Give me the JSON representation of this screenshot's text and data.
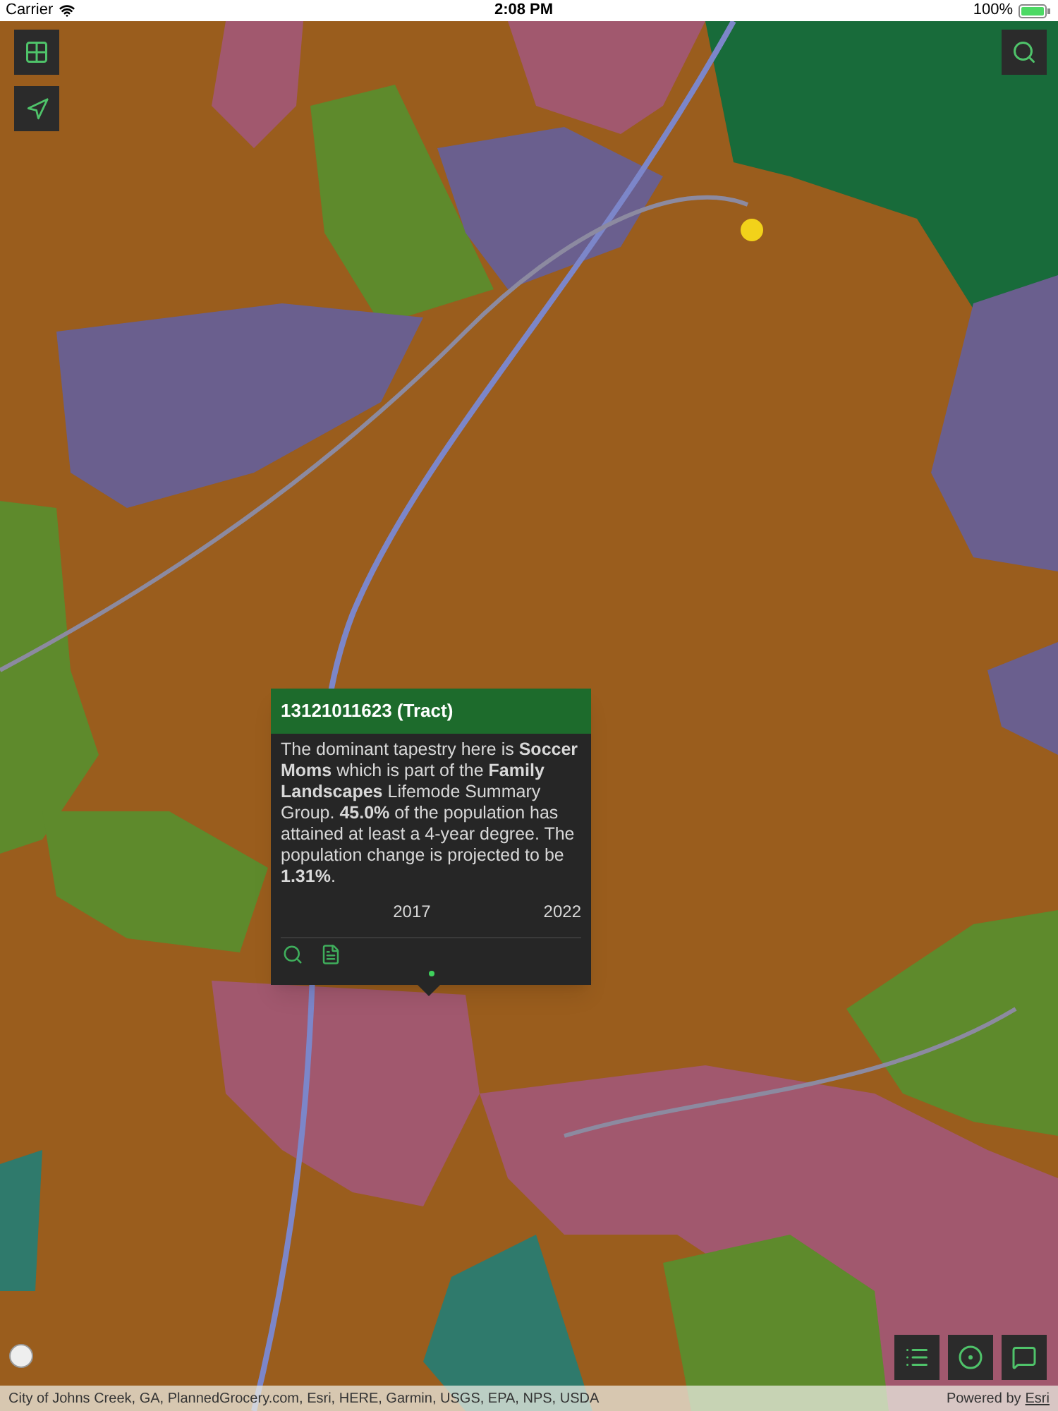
{
  "status_bar": {
    "carrier": "Carrier",
    "time": "2:08 PM",
    "battery": "100%"
  },
  "popup": {
    "title": "13121011623 (Tract)",
    "description": "The dominant tapestry here is **Soccer Moms** which is part of the **Family Landscapes** Lifemode Summary Group. **45.0%** of the population has attained at least a 4-year degree. The population change is projected to be **1.31%**.",
    "table": {
      "columns": [
        "2017",
        "2022"
      ]
    },
    "page_dots": [
      {
        "selected": true
      }
    ]
  },
  "attribution": {
    "sources": "City of Johns Creek, GA, PlannedGrocery.com, Esri, HERE, Garmin, USGS, EPA, NPS, USDA",
    "powered_by": "Powered by",
    "link": "Esri"
  }
}
